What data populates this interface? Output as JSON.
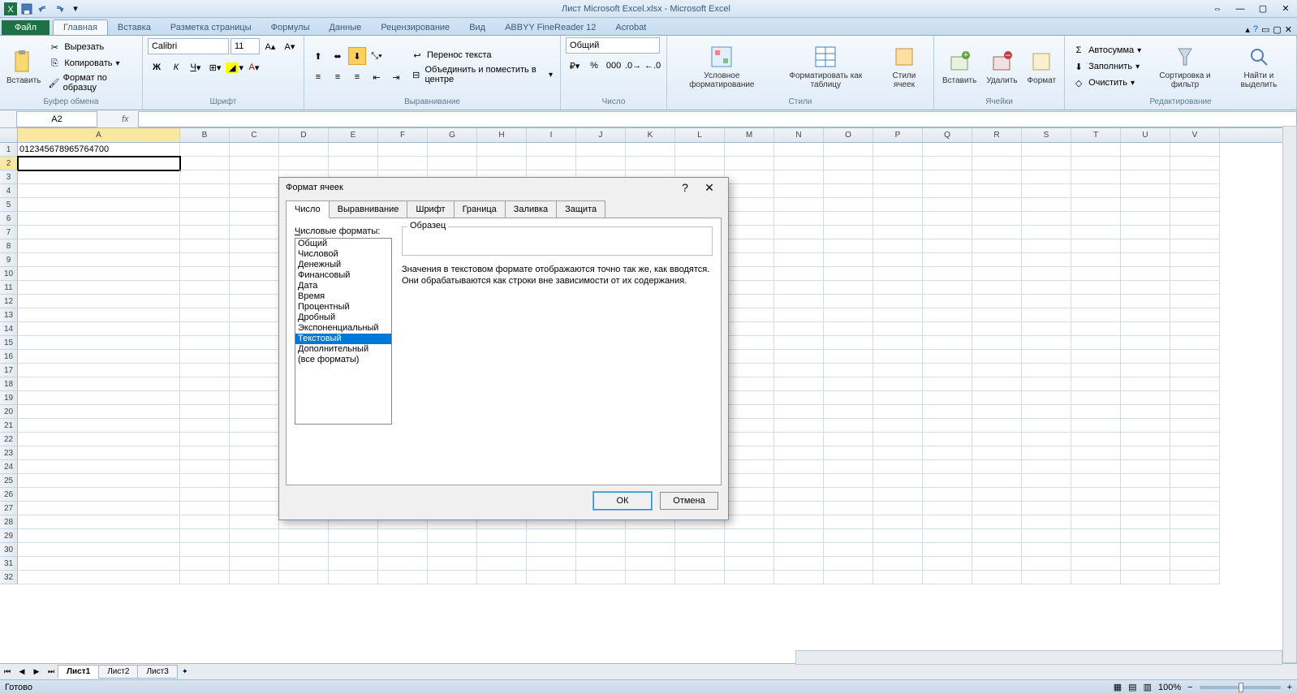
{
  "title": "Лист Microsoft Excel.xlsx - Microsoft Excel",
  "ribbon_tabs": {
    "file": "Файл",
    "home": "Главная",
    "insert": "Вставка",
    "page_layout": "Разметка страницы",
    "formulas": "Формулы",
    "data": "Данные",
    "review": "Рецензирование",
    "view": "Вид",
    "abbyy": "ABBYY FineReader 12",
    "acrobat": "Acrobat"
  },
  "clipboard": {
    "paste": "Вставить",
    "cut": "Вырезать",
    "copy": "Копировать",
    "format_painter": "Формат по образцу",
    "group": "Буфер обмена"
  },
  "font": {
    "name": "Calibri",
    "size": "11",
    "group": "Шрифт"
  },
  "alignment": {
    "wrap": "Перенос текста",
    "merge": "Объединить и поместить в центре",
    "group": "Выравнивание"
  },
  "number": {
    "format": "Общий",
    "group": "Число"
  },
  "styles": {
    "conditional": "Условное форматирование",
    "table": "Форматировать как таблицу",
    "cell": "Стили ячеек",
    "group": "Стили"
  },
  "cells": {
    "insert": "Вставить",
    "delete": "Удалить",
    "format": "Формат",
    "group": "Ячейки"
  },
  "editing": {
    "autosum": "Автосумма",
    "fill": "Заполнить",
    "clear": "Очистить",
    "sort": "Сортировка и фильтр",
    "find": "Найти и выделить",
    "group": "Редактирование"
  },
  "name_box": "A2",
  "formula": "",
  "columns": [
    "A",
    "B",
    "C",
    "D",
    "E",
    "F",
    "G",
    "H",
    "I",
    "J",
    "K",
    "L",
    "M",
    "N",
    "O",
    "P",
    "Q",
    "R",
    "S",
    "T",
    "U",
    "V"
  ],
  "cell_a1": "012345678965764700",
  "dialog": {
    "title": "Формат ячеек",
    "tabs": [
      "Число",
      "Выравнивание",
      "Шрифт",
      "Граница",
      "Заливка",
      "Защита"
    ],
    "formats_label": "Числовые форматы:",
    "formats": [
      "Общий",
      "Числовой",
      "Денежный",
      "Финансовый",
      "Дата",
      "Время",
      "Процентный",
      "Дробный",
      "Экспоненциальный",
      "Текстовый",
      "Дополнительный",
      "(все форматы)"
    ],
    "selected_format": "Текстовый",
    "sample_label": "Образец",
    "description": "Значения в текстовом формате отображаются точно так же, как вводятся. Они обрабатываются как строки вне зависимости от их содержания.",
    "ok": "ОК",
    "cancel": "Отмена"
  },
  "sheets": [
    "Лист1",
    "Лист2",
    "Лист3"
  ],
  "status": "Готово",
  "zoom": "100%"
}
